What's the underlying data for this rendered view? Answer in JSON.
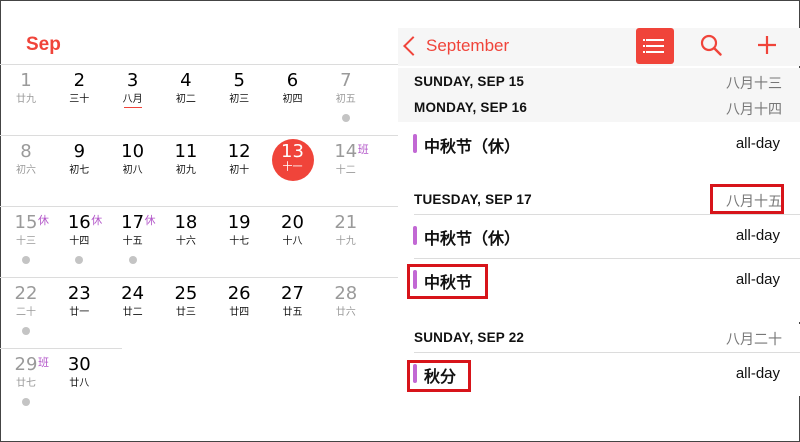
{
  "month_view": {
    "title": "Sep",
    "weeks": [
      [
        {
          "day": "1",
          "lunar": "廿九",
          "weekend": true
        },
        {
          "day": "2",
          "lunar": "三十"
        },
        {
          "day": "3",
          "lunar": "八月",
          "lunar_highlight": true
        },
        {
          "day": "4",
          "lunar": "初二"
        },
        {
          "day": "5",
          "lunar": "初三"
        },
        {
          "day": "6",
          "lunar": "初四"
        },
        {
          "day": "7",
          "lunar": "初五",
          "weekend": true,
          "dot": true
        }
      ],
      [
        {
          "day": "8",
          "lunar": "初六",
          "weekend": true
        },
        {
          "day": "9",
          "lunar": "初七"
        },
        {
          "day": "10",
          "lunar": "初八"
        },
        {
          "day": "11",
          "lunar": "初九"
        },
        {
          "day": "12",
          "lunar": "初十"
        },
        {
          "day": "13",
          "lunar": "十一",
          "today": true
        },
        {
          "day": "14",
          "lunar": "十二",
          "weekend": true,
          "badge": "班"
        }
      ],
      [
        {
          "day": "15",
          "lunar": "十三",
          "weekend": true,
          "badge": "休",
          "dot": true
        },
        {
          "day": "16",
          "lunar": "十四",
          "badge": "休",
          "dot": true
        },
        {
          "day": "17",
          "lunar": "十五",
          "badge": "休",
          "dot": true
        },
        {
          "day": "18",
          "lunar": "十六"
        },
        {
          "day": "19",
          "lunar": "十七"
        },
        {
          "day": "20",
          "lunar": "十八"
        },
        {
          "day": "21",
          "lunar": "十九",
          "weekend": true
        }
      ],
      [
        {
          "day": "22",
          "lunar": "二十",
          "weekend": true,
          "dot": true
        },
        {
          "day": "23",
          "lunar": "廿一"
        },
        {
          "day": "24",
          "lunar": "廿二"
        },
        {
          "day": "25",
          "lunar": "廿三"
        },
        {
          "day": "26",
          "lunar": "廿四"
        },
        {
          "day": "27",
          "lunar": "廿五"
        },
        {
          "day": "28",
          "lunar": "廿六",
          "weekend": true
        }
      ],
      [
        {
          "day": "29",
          "lunar": "廿七",
          "weekend": true,
          "badge": "班",
          "dot": true
        },
        {
          "day": "30",
          "lunar": "廿八"
        }
      ]
    ]
  },
  "list_view": {
    "back_label": "September",
    "icons": {
      "list": "list-icon",
      "search": "search-icon",
      "add": "plus-icon"
    },
    "accent_color": "#f0443a",
    "event_color": "#c268d4",
    "sections": [
      {
        "day": "SUNDAY, SEP 15",
        "lunar": "八月十三",
        "events": []
      },
      {
        "day": "MONDAY, SEP 16",
        "lunar": "八月十四",
        "events": [
          {
            "title": "中秋节（休）",
            "time": "all-day"
          }
        ]
      },
      {
        "day": "TUESDAY, SEP 17",
        "lunar": "八月十五",
        "lunar_highlight": true,
        "events": [
          {
            "title": "中秋节（休）",
            "time": "all-day"
          },
          {
            "title": "中秋节",
            "time": "all-day",
            "highlight": true
          }
        ]
      },
      {
        "day": "SUNDAY, SEP 22",
        "lunar": "八月二十",
        "events": [
          {
            "title": "秋分",
            "time": "all-day",
            "highlight": true
          }
        ]
      }
    ]
  }
}
